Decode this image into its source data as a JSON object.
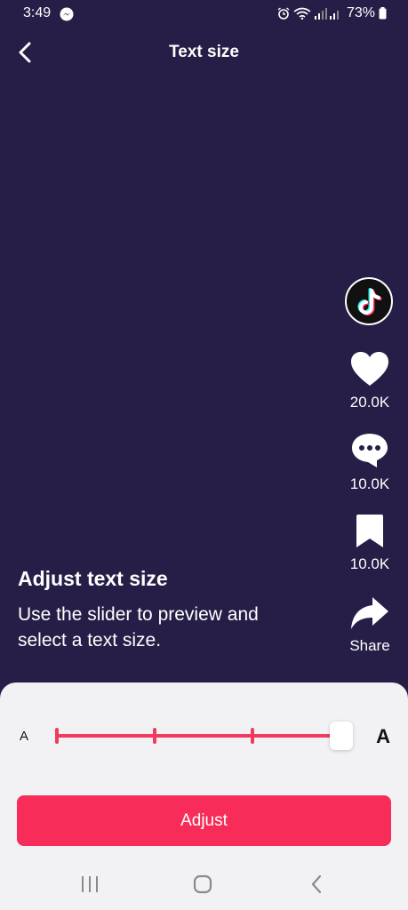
{
  "status_bar": {
    "time": "3:49",
    "battery": "73%"
  },
  "header": {
    "title": "Text size"
  },
  "rail": {
    "likes": "20.0K",
    "comments": "10.0K",
    "saves": "10.0K",
    "share": "Share"
  },
  "intro": {
    "title": "Adjust text size",
    "body": "Use the slider to preview and select a text size."
  },
  "text_size": {
    "small_label": "A",
    "large_label": "A",
    "levels": 4,
    "selected_level": 4,
    "button_label": "Adjust"
  },
  "colors": {
    "background": "#261e47",
    "accent": "#f72c59",
    "sheet": "#f2f2f4"
  },
  "icons": [
    "messenger-icon",
    "alarm-icon",
    "wifi-icon",
    "signal-icon",
    "battery-icon",
    "back-arrow-icon",
    "tiktok-logo-icon",
    "heart-icon",
    "comment-icon",
    "bookmark-icon",
    "share-arrow-icon",
    "recent-apps-icon",
    "home-icon",
    "nav-back-icon"
  ]
}
